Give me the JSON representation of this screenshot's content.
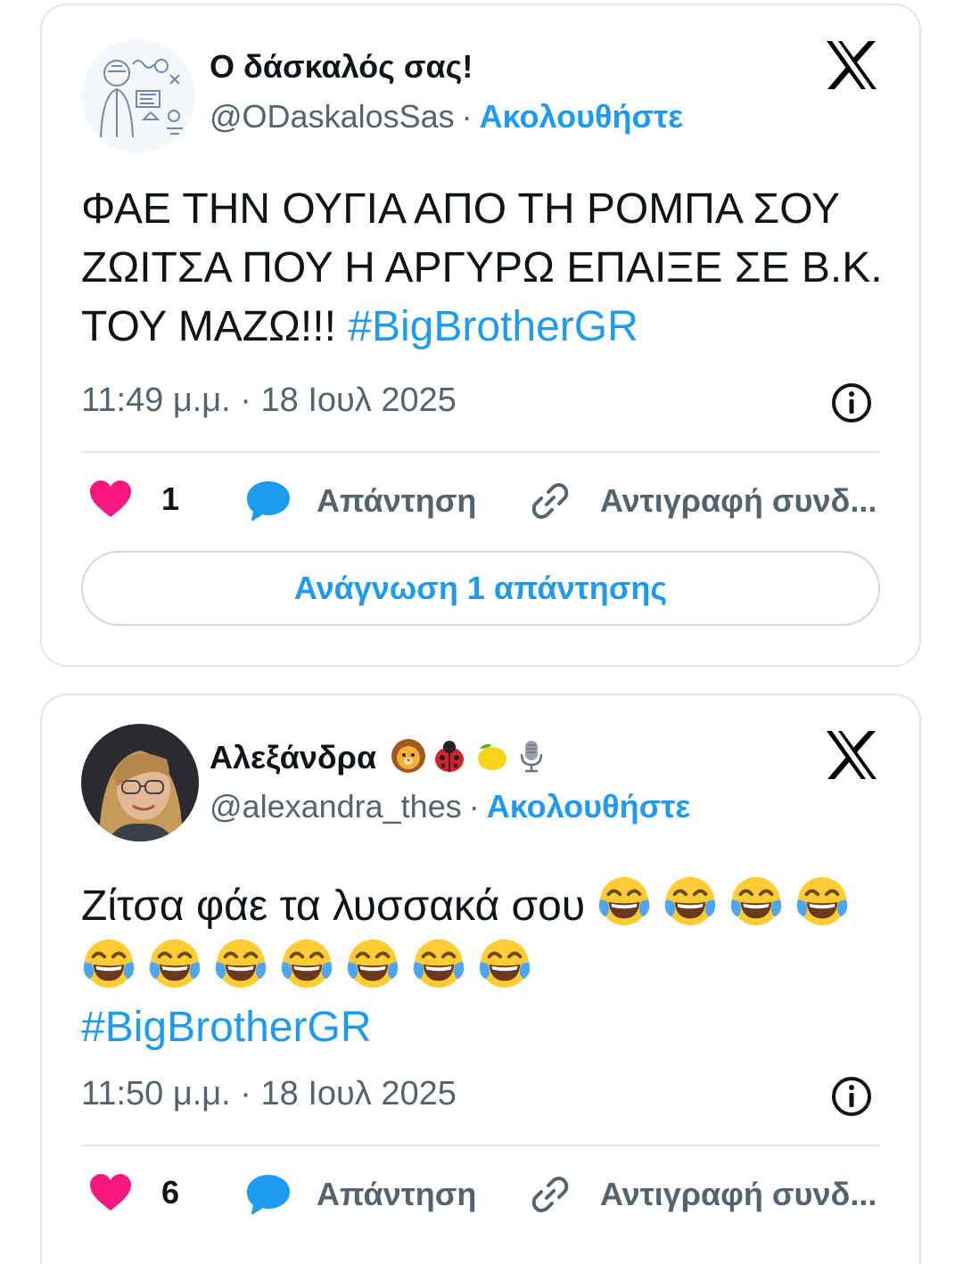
{
  "tweets": [
    {
      "author_name": "Ο δάσκαλός σας!",
      "handle": "@ODaskalosSas",
      "separator": "·",
      "follow_label": "Ακολουθήστε",
      "text": "ΦΑΕ ΤΗΝ ΟΥΓΙΑ ΑΠΟ ΤΗ ΡΟΜΠΑ ΣΟΥ ΖΩΙΤΣΑ ΠΟΥ Η ΑΡΓΥΡΩ ΕΠΑΙΞΕ ΣΕ Β.Κ. ΤΟΥ ΜΑΖΩ!!!",
      "hashtag": "#BigBrotherGR",
      "timestamp": "11:49 μ.μ. · 18 Ιουλ 2025",
      "like_count": "1",
      "reply_label": "Απάντηση",
      "copy_link_label": "Αντιγραφή συνδ...",
      "read_replies_label": "Ανάγνωση 1 απάντησης"
    },
    {
      "author_name": "Αλεξάνδρα",
      "name_emojis": [
        "lion-face",
        "lady-beetle",
        "lemon",
        "studio-microphone"
      ],
      "handle": "@alexandra_thes",
      "separator": "·",
      "follow_label": "Ακολουθήστε",
      "text": "Ζίτσα φάε τα λυσσακά σου",
      "emoji": "face-with-tears-of-joy",
      "emoji_count": 11,
      "hashtag": "#BigBrotherGR",
      "timestamp": "11:50 μ.μ. · 18 Ιουλ 2025",
      "like_count": "6",
      "reply_label": "Απάντηση",
      "copy_link_label": "Αντιγραφή συνδ..."
    }
  ],
  "colors": {
    "accent": "#1d9bf0",
    "like": "#f91880",
    "secondary_text": "#536471",
    "border": "#e3e6e9"
  },
  "icons": [
    "x-logo-icon",
    "info-icon",
    "heart-icon",
    "reply-bubble-icon",
    "link-icon"
  ]
}
